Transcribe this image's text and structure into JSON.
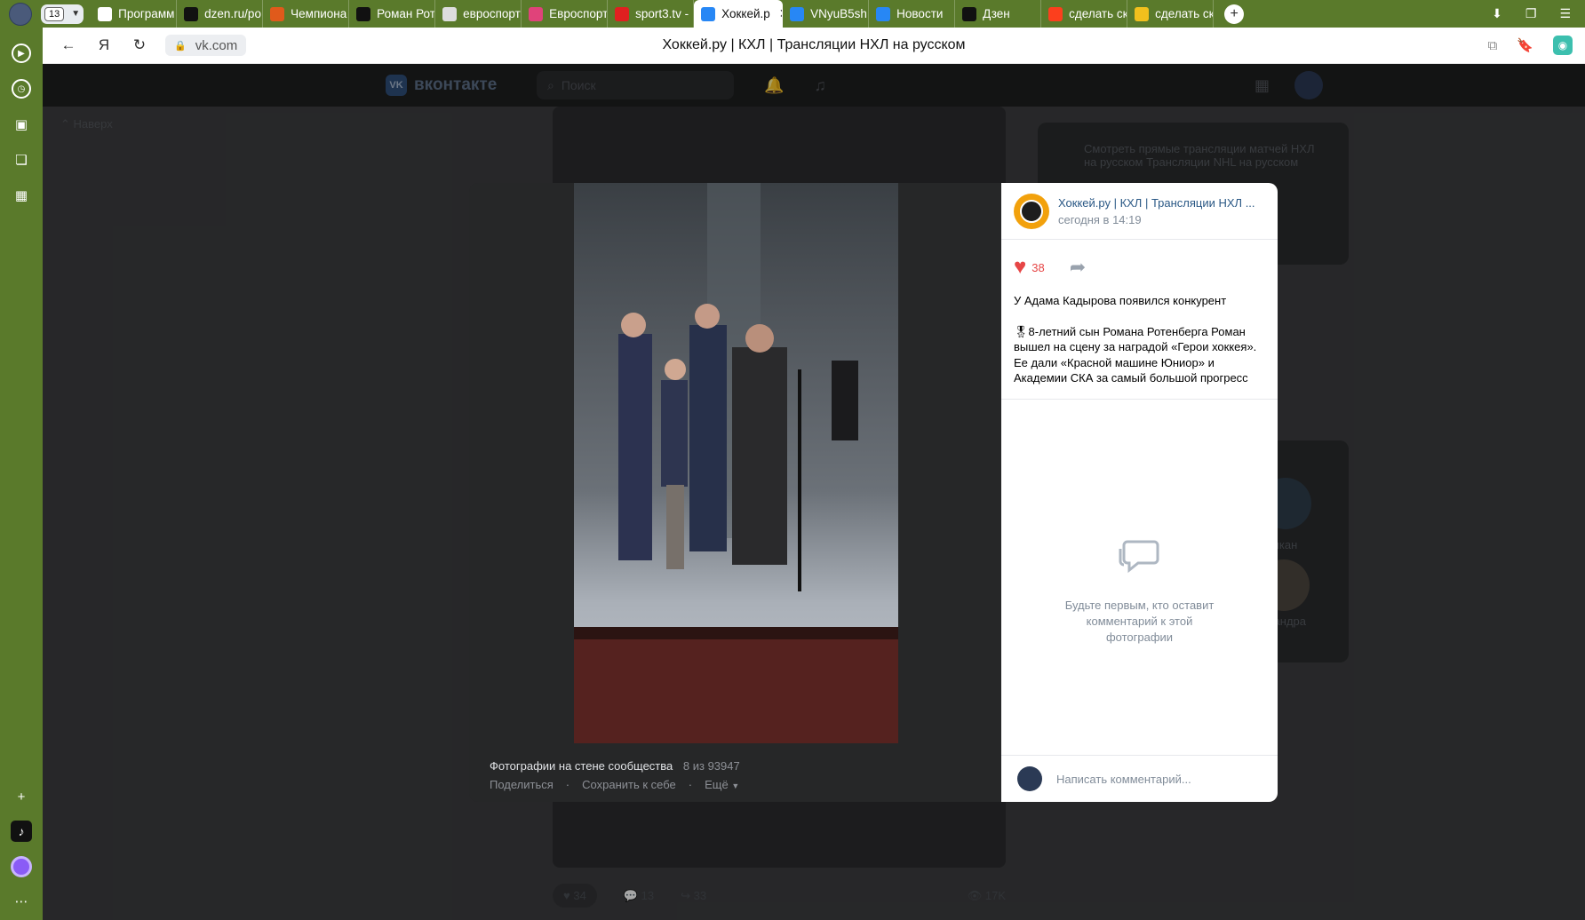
{
  "browser": {
    "tab_count": "13",
    "tabs": [
      {
        "label": "Программ",
        "icon": "chat-icon",
        "active": false
      },
      {
        "label": "dzen.ru/ро",
        "icon": "dzen-icon",
        "active": false
      },
      {
        "label": "Чемпиона",
        "icon": "sport-icon",
        "active": false
      },
      {
        "label": "Роман Рот",
        "icon": "s-icon",
        "active": false
      },
      {
        "label": "евроспорт",
        "icon": "page-icon",
        "active": false
      },
      {
        "label": "Евроспорт",
        "icon": "video-icon",
        "active": false
      },
      {
        "label": "sport3.tv -",
        "icon": "sport3-icon",
        "active": false
      },
      {
        "label": "Хоккей.р",
        "icon": "vk-icon",
        "active": true
      },
      {
        "label": "VNyuB5sh",
        "icon": "vk-icon",
        "active": false
      },
      {
        "label": "Новости",
        "icon": "vk-icon",
        "active": false
      },
      {
        "label": "Дзен",
        "icon": "dzen-icon",
        "active": false
      },
      {
        "label": "сделать ск",
        "icon": "yandex-icon",
        "active": false
      },
      {
        "label": "сделать ск",
        "icon": "image-icon",
        "active": false
      }
    ],
    "url": "vk.com",
    "page_title": "Хоккей.ру | КХЛ | Трансляции НХЛ на русском",
    "accent": "#5a7a2b"
  },
  "vk": {
    "logo": "вконтакте",
    "search_placeholder": "Поиск",
    "naverh": "Наверх",
    "right_block": "Смотреть прямые трансляции матчей НХЛ на русском Трансляции NHL на русском",
    "feed_likes": "34",
    "feed_comments": "13",
    "feed_shares": "33",
    "feed_views": "17K",
    "friend1": "Викан",
    "friend2": "ександра"
  },
  "viewer": {
    "album": "Фотографии на стене сообщества",
    "counter": "8 из 93947",
    "share": "Поделиться",
    "save": "Сохранить к себе",
    "more": "Ещё",
    "group_name": "Хоккей.ру | КХЛ | Трансляции НХЛ ...",
    "post_time": "сегодня в 14:19",
    "likes": "38",
    "text_p1": "У Адама Кадырова появился конкурент",
    "text_p2": "🎖8-летний сын Романа Ротенберга Роман вышел на сцену за наградой «Герои хоккея». Ее дали «Красной машине Юниор» и Академии СКА за самый большой прогресс",
    "empty_comments": "Будьте первым, кто оставит комментарий к этой фотографии",
    "comment_placeholder": "Написать комментарий..."
  }
}
